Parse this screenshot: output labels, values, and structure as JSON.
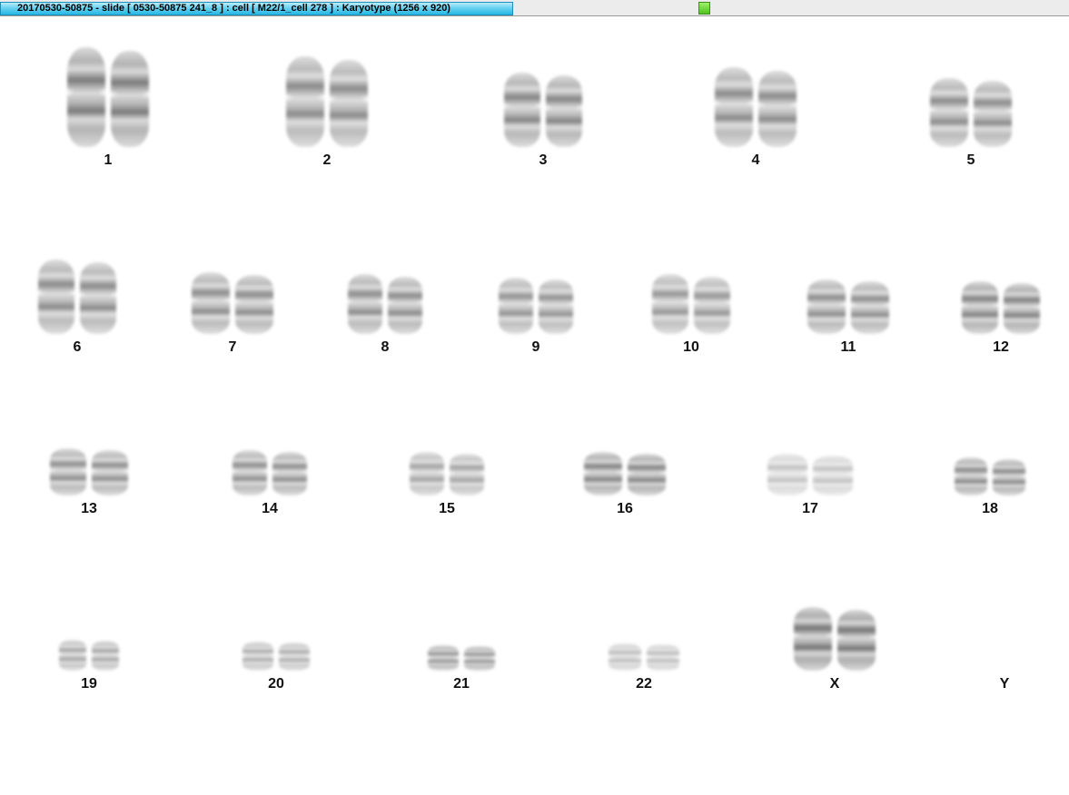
{
  "window": {
    "title": "20170530-50875 - slide [ 0530-50875 241_8 ] : cell [ M22/1_cell 278 ] : Karyotype  (1256 x 920)",
    "status_color": "#5ccc2a"
  },
  "karyotype": {
    "chromosomes": [
      {
        "label": "1"
      },
      {
        "label": "2"
      },
      {
        "label": "3"
      },
      {
        "label": "4"
      },
      {
        "label": "5"
      },
      {
        "label": "6"
      },
      {
        "label": "7"
      },
      {
        "label": "8"
      },
      {
        "label": "9"
      },
      {
        "label": "10"
      },
      {
        "label": "11"
      },
      {
        "label": "12"
      },
      {
        "label": "13"
      },
      {
        "label": "14"
      },
      {
        "label": "15"
      },
      {
        "label": "16"
      },
      {
        "label": "17"
      },
      {
        "label": "18"
      },
      {
        "label": "19"
      },
      {
        "label": "20"
      },
      {
        "label": "21"
      },
      {
        "label": "22"
      },
      {
        "label": "X"
      },
      {
        "label": "Y"
      }
    ]
  }
}
